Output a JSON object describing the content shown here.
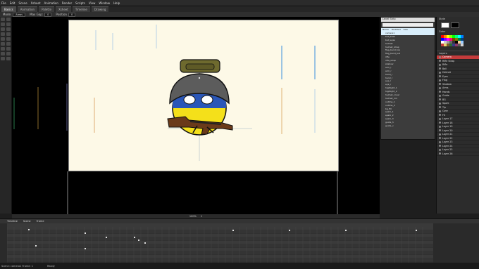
{
  "app": {
    "menu": [
      "File",
      "Edit",
      "Scene",
      "Xsheet",
      "Animation",
      "Render",
      "Scripts",
      "View",
      "Window",
      "Help"
    ]
  },
  "tabs": [
    "Basics",
    "Animation",
    "Palette",
    "Xsheet",
    "Timeline",
    "Drawing"
  ],
  "tool_options": {
    "mode_label": "Mode:",
    "mode_value": "Areas",
    "max_gap_label": "Max Gap:",
    "max_gap_value": "0",
    "position_label": "Position",
    "position_value": "0"
  },
  "library": {
    "title": "Level Strip",
    "column_headers": [
      "Name",
      "Modified",
      "Size"
    ],
    "items": [
      "camera1",
      "ball_base",
      "ball_eyes",
      "helmet",
      "helmet_strap",
      "flag_band_top",
      "flag_band_bot",
      "rifle",
      "rifle_strap",
      "shadow",
      "arm_l",
      "arm_r",
      "hand_l",
      "hand_r",
      "eye_l",
      "eye_r",
      "highlight_1",
      "highlight_2",
      "helmet_cover",
      "helmet_rim",
      "outline_1",
      "outline_2",
      "bg_fill",
      "spark_1",
      "spark_2",
      "spark_3",
      "guide_h",
      "guide_v"
    ]
  },
  "right_panel": {
    "style_label": "Style",
    "color_label": "Color",
    "layers_label": "Layers",
    "layers": [
      "Camera",
      "Rifle Strap",
      "Rifle",
      "Ball",
      "Helmet",
      "Eyes",
      "Flag",
      "Shadow",
      "Arms",
      "Hands",
      "Guide",
      "BG",
      "Spark",
      "Tip",
      "Over",
      "FX",
      "Layer 17",
      "Layer 18",
      "Layer 19",
      "Layer 20",
      "Layer 21",
      "Layer 22",
      "Layer 23",
      "Layer 24",
      "Layer 25",
      "Layer 26"
    ],
    "colors": {
      "layer_selected": "#c43b3b",
      "ukraine_blue": "#2a56b8",
      "ukraine_yellow": "#f4e01a",
      "helmet_green": "#6e6a2e"
    },
    "swatch_colors": [
      "#ff0000",
      "#ff8000",
      "#ffff00",
      "#80ff00",
      "#00ff00",
      "#00ff80",
      "#00ffff",
      "#0080ff",
      "#0000ff",
      "#8000ff",
      "#ff00ff",
      "#ff0080",
      "#804000",
      "#808000",
      "#008040",
      "#004080",
      "#ffffff",
      "#cccccc",
      "#999999",
      "#666666",
      "#333333",
      "#000000",
      "#ffcc99",
      "#99ccff",
      "#c43b3b",
      "#e8d36a",
      "#7a5a2a",
      "#2a6a3a",
      "#3a3a8a",
      "#8a3a6a",
      "#5a5a5a",
      "#d0d0d0"
    ]
  },
  "viewer": {
    "footer_zoom": "100%",
    "footer_frame": "1"
  },
  "timeline": {
    "label": "Timeline",
    "scene": "Scene",
    "frame": "Frame"
  },
  "status": {
    "left": "Scene: camera1  Frame: 1",
    "right": "Ready"
  }
}
